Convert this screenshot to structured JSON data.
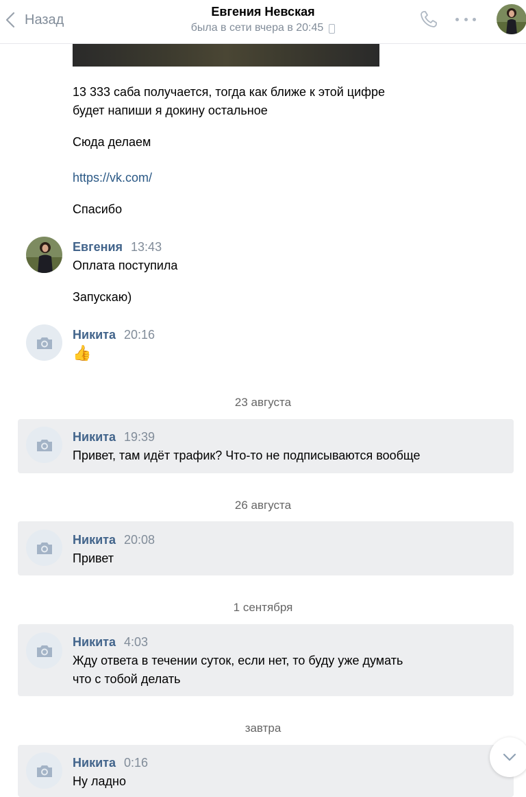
{
  "header": {
    "back_label": "Назад",
    "title": "Евгения Невская",
    "status": "была в сети вчера в 20:45"
  },
  "messages_top": {
    "line1": "13 333 саба получается, тогда как ближе к этой цифре",
    "line2": "будет напиши я докину остальное",
    "here": "Сюда делаем",
    "link": "https://vk.com/",
    "thanks": "Спасибо"
  },
  "group_evgenia": {
    "name": "Евгения",
    "time": "13:43",
    "msg1": "Оплата поступила",
    "msg2": "Запускаю)"
  },
  "group_nikita_1": {
    "name": "Никита",
    "time": "20:16",
    "emoji": "👍"
  },
  "date_1": "23 августа",
  "group_nikita_2": {
    "name": "Никита",
    "time": "19:39",
    "text": "Привет, там идёт трафик? Что-то не подписываются вообще"
  },
  "date_2": "26 августа",
  "group_nikita_3": {
    "name": "Никита",
    "time": "20:08",
    "text": "Привет"
  },
  "date_3": "1 сентября",
  "group_nikita_4": {
    "name": "Никита",
    "time": "4:03",
    "line1": "Жду ответа в течении суток, если нет, то буду уже думать",
    "line2": "что с тобой делать"
  },
  "date_4": "завтра",
  "group_nikita_5": {
    "name": "Никита",
    "time": "0:16",
    "text": "Ну ладно"
  },
  "icons": {
    "back": "chevron-left-icon",
    "call": "phone-icon",
    "more": "more-dots-icon",
    "camera": "camera-icon",
    "scroll": "chevron-down-icon"
  },
  "colors": {
    "accent_name": "#42648b",
    "link": "#2a5885",
    "muted": "#818c99",
    "unread_bg": "#edeef0"
  }
}
